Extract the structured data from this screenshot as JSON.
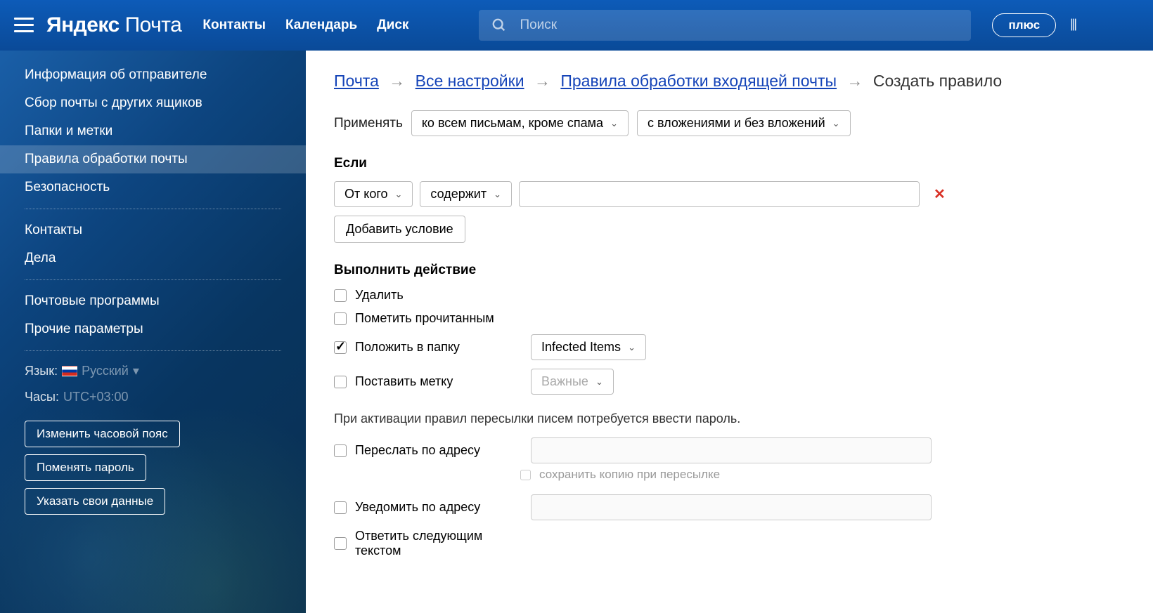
{
  "header": {
    "logo_bold": "Яндекс",
    "logo_thin": "Почта",
    "nav": {
      "contacts": "Контакты",
      "calendar": "Календарь",
      "disk": "Диск"
    },
    "search_placeholder": "Поиск",
    "plus": "плюс"
  },
  "sidebar": {
    "items": [
      "Информация об отправителе",
      "Сбор почты с других ящиков",
      "Папки и метки",
      "Правила обработки почты",
      "Безопасность"
    ],
    "group2": [
      "Контакты",
      "Дела"
    ],
    "group3": [
      "Почтовые программы",
      "Прочие параметры"
    ],
    "lang_label": "Язык:",
    "lang_value": "Русский",
    "clock_label": "Часы:",
    "clock_value": "UTC+03:00",
    "buttons": [
      "Изменить часовой пояс",
      "Поменять пароль",
      "Указать свои данные"
    ]
  },
  "breadcrumb": {
    "mail": "Почта",
    "all_settings": "Все настройки",
    "rules": "Правила обработки входящей почты",
    "current": "Создать правило"
  },
  "apply": {
    "label": "Применять",
    "opt1": "ко всем письмам, кроме спама",
    "opt2": "с вложениями и без вложений"
  },
  "if": {
    "title": "Если",
    "from": "От кого",
    "contains": "содержит",
    "add": "Добавить условие"
  },
  "action": {
    "title": "Выполнить действие",
    "delete": "Удалить",
    "mark_read": "Пометить прочитанным",
    "move_to": "Положить в папку",
    "folder": "Infected Items",
    "set_label": "Поставить метку",
    "label_value": "Важные",
    "note": "При активации правил пересылки писем потребуется ввести пароль.",
    "forward": "Переслать по адресу",
    "keep_copy": "сохранить копию при пересылке",
    "notify": "Уведомить по адресу",
    "reply": "Ответить следующим текстом"
  }
}
